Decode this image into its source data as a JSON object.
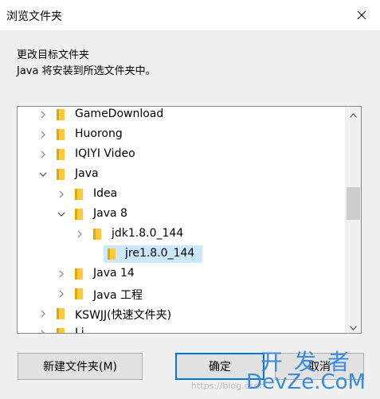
{
  "window": {
    "title": "浏览文件夹",
    "close_icon": "close-icon"
  },
  "instructions": {
    "line1": "更改目标文件夹",
    "line2": "Java 将安装到所选文件夹中。"
  },
  "tree": {
    "items": [
      {
        "label": "GameDownload",
        "level": 0,
        "expander": "collapsed"
      },
      {
        "label": "Huorong",
        "level": 0,
        "expander": "collapsed"
      },
      {
        "label": "IQIYI Video",
        "level": 0,
        "expander": "collapsed"
      },
      {
        "label": "Java",
        "level": 0,
        "expander": "expanded"
      },
      {
        "label": "Idea",
        "level": 1,
        "expander": "collapsed"
      },
      {
        "label": "Java 8",
        "level": 1,
        "expander": "expanded"
      },
      {
        "label": "jdk1.8.0_144",
        "level": 2,
        "expander": "collapsed"
      },
      {
        "label": "jre1.8.0_144",
        "level": 2,
        "expander": "none",
        "selected": true
      },
      {
        "label": "Java 14",
        "level": 1,
        "expander": "collapsed"
      },
      {
        "label": "Java 工程",
        "level": 1,
        "expander": "collapsed"
      },
      {
        "label": "KSWJJ(快速文件夹)",
        "level": 0,
        "expander": "collapsed"
      },
      {
        "label": "Li...",
        "level": 0,
        "expander": "collapsed"
      }
    ],
    "scroll_position": 0.4
  },
  "buttons": {
    "new_folder": "新建文件夹(M)",
    "ok": "确定",
    "cancel": "取消"
  },
  "watermark": {
    "top": "开发者",
    "bottom": "DevZe.CoM",
    "url": "https://blog.csdn"
  },
  "colors": {
    "folder": "#ffc83d",
    "selection": "#cce8ff",
    "focus": "#0078d7",
    "watermark": "#3a8be0"
  }
}
